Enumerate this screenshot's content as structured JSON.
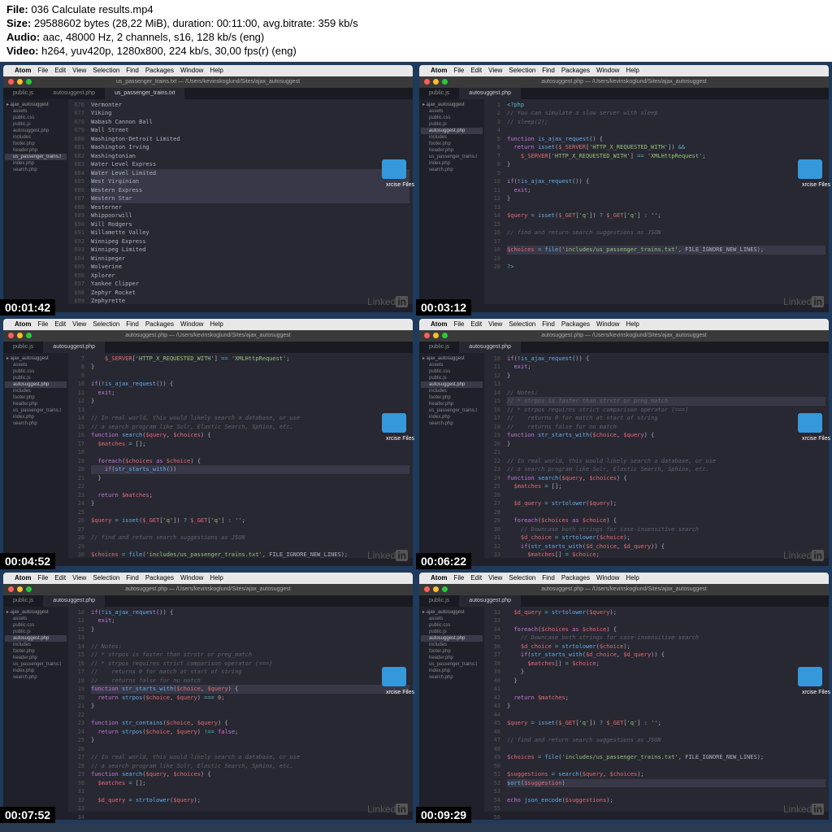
{
  "metadata": {
    "file_label": "File:",
    "file_name": "036 Calculate results.mp4",
    "size_label": "Size:",
    "size_value": "29588602 bytes (28,22 MiB), duration: 00:11:00, avg.bitrate: 359 kb/s",
    "audio_label": "Audio:",
    "audio_value": "aac, 48000 Hz, 2 channels, s16, 128 kb/s (eng)",
    "video_label": "Video:",
    "video_value": "h264, yuv420p, 1280x800, 224 kb/s, 30,00 fps(r) (eng)"
  },
  "menubar": {
    "apple": "",
    "items": [
      "Atom",
      "File",
      "Edit",
      "View",
      "Selection",
      "Find",
      "Packages",
      "Window",
      "Help"
    ]
  },
  "sidebar": {
    "folders": [
      {
        "name": "ajax_autosuggest",
        "files": [
          {
            "name": "assets"
          },
          {
            "name": "public.css"
          },
          {
            "name": "public.js"
          },
          {
            "name": "autosuggest.php"
          },
          {
            "name": "includes"
          },
          {
            "name": "footer.php"
          },
          {
            "name": "header.php"
          },
          {
            "name": "us_passenger_trains.t"
          },
          {
            "name": "index.php"
          },
          {
            "name": "search.php"
          }
        ]
      }
    ]
  },
  "tabs_both": [
    "public.js",
    "autosuggest.php"
  ],
  "window_title_trains": "us_passenger_trains.txt — /Users/kevinskoglund/Sites/ajax_autosuggest",
  "window_title_php": "autosuggest.php — /Users/kevinskoglund/Sites/ajax_autosuggest",
  "desktop_folder": "xrcise Files",
  "linkedin": "Linked",
  "linkedin_in": "in",
  "frames": [
    {
      "time": "00:01:42",
      "title": "us_passenger_trains.txt — /Users/kevinskoglund/Sites/ajax_autosuggest",
      "tabs": [
        "public.js",
        "autosuggest.php",
        "us_passenger_trains.txt"
      ],
      "active_tab": 2,
      "gutter_start": 676,
      "highlight": [
        684,
        685,
        686,
        687
      ],
      "lines": [
        "Vermonter",
        "Viking",
        "Wabash Cannon Ball",
        "Wall Street",
        "Washington-Detroit Limited",
        "Washington Irving",
        "Washingtonian",
        "Water Level Express",
        "Water Level Limited",
        "West Virginian",
        "Western Express",
        "Western Star",
        "Westerner",
        "Whippoorwill",
        "Will Rodgers",
        "Willamette Valley",
        "Winnipeg Express",
        "Winnipeg Limited",
        "Winnipeger",
        "Wolverine",
        "Xplorer",
        "Yankee Clipper",
        "Zephyr Rocket",
        "Zephyrette"
      ]
    },
    {
      "time": "00:03:12",
      "title": "autosuggest.php — /Users/kevinskoglund/Sites/ajax_autosuggest",
      "tabs": [
        "public.js",
        "autosuggest.php"
      ],
      "active_tab": 1,
      "gutter_start": 1,
      "highlight": [
        18
      ],
      "code": "<span class='c-op'>&lt;?php</span>\n<span class='c-com'>// You can simulate a slow server with sleep</span>\n<span class='c-com'>// sleep(2);</span>\n\n<span class='c-kw'>function</span> <span class='c-fn'>is_ajax_request</span>() {\n  <span class='c-kw'>return</span> <span class='c-fn'>isset</span>(<span class='c-var'>$_SERVER</span>[<span class='c-str'>'HTTP_X_REQUESTED_WITH'</span>]) <span class='c-op'>&&</span>\n    <span class='c-var'>$_SERVER</span>[<span class='c-str'>'HTTP_X_REQUESTED_WITH'</span>] <span class='c-op'>==</span> <span class='c-str'>'XMLHttpRequest'</span>;\n}\n\n<span class='c-kw'>if</span>(!<span class='c-fn'>is_ajax_request</span>()) {\n  <span class='c-kw'>exit</span>;\n}\n\n<span class='c-var'>$query</span> <span class='c-op'>=</span> <span class='c-fn'>isset</span>(<span class='c-var'>$_GET</span>[<span class='c-str'>'q'</span>]) <span class='c-op'>?</span> <span class='c-var'>$_GET</span>[<span class='c-str'>'q'</span>] <span class='c-op'>:</span> <span class='c-str'>''</span>;\n\n<span class='c-com'>// find and return search suggestions as JSON</span>\n\n<span class='hl-line'><span class='c-var'>$choices</span> <span class='c-op'>=</span> <span class='c-fn'>file</span>(<span class='c-str'>'includes/us_passenger_trains.txt'</span>, FILE_IGNORE_NEW_LINES);</span>\n\n<span class='c-op'>?&gt;</span>"
    },
    {
      "time": "00:04:52",
      "title": "autosuggest.php — /Users/kevinskoglund/Sites/ajax_autosuggest",
      "tabs": [
        "public.js",
        "autosuggest.php"
      ],
      "active_tab": 1,
      "gutter_start": 7,
      "highlight": [
        20
      ],
      "code": "    <span class='c-var'>$_SERVER</span>[<span class='c-str'>'HTTP_X_REQUESTED_WITH'</span>] <span class='c-op'>==</span> <span class='c-str'>'XMLHttpRequest'</span>;\n}\n\n<span class='c-kw'>if</span>(!<span class='c-fn'>is_ajax_request</span>()) {\n  <span class='c-kw'>exit</span>;\n}\n\n<span class='c-com'>// In real world, this would likely search a database, or use</span>\n<span class='c-com'>// a search program like Solr, Elastic Search, Sphinx, etc.</span>\n<span class='c-kw'>function</span> <span class='c-fn'>search</span>(<span class='c-var'>$query</span>, <span class='c-var'>$choices</span>) {\n  <span class='c-var'>$matches</span> <span class='c-op'>=</span> [];\n\n  <span class='c-kw'>foreach</span>(<span class='c-var'>$choices</span> <span class='c-kw'>as</span> <span class='c-var'>$choice</span>) {\n<span class='hl-line'>    <span class='c-kw'>if</span>(<span class='c-fn'>str_starts_with</span>())</span>\n  }\n\n  <span class='c-kw'>return</span> <span class='c-var'>$matches</span>;\n}\n\n<span class='c-var'>$query</span> <span class='c-op'>=</span> <span class='c-fn'>isset</span>(<span class='c-var'>$_GET</span>[<span class='c-str'>'q'</span>]) <span class='c-op'>?</span> <span class='c-var'>$_GET</span>[<span class='c-str'>'q'</span>] <span class='c-op'>:</span> <span class='c-str'>''</span>;\n\n<span class='c-com'>// find and return search suggestions as JSON</span>\n\n<span class='c-var'>$choices</span> <span class='c-op'>=</span> <span class='c-fn'>file</span>(<span class='c-str'>'includes/us_passenger_trains.txt'</span>, FILE_IGNORE_NEW_LINES);"
    },
    {
      "time": "00:06:22",
      "title": "autosuggest.php — /Users/kevinskoglund/Sites/ajax_autosuggest",
      "tabs": [
        "public.js",
        "autosuggest.php"
      ],
      "active_tab": 1,
      "gutter_start": 10,
      "highlight": [
        15
      ],
      "code": "<span class='c-kw'>if</span>(!<span class='c-fn'>is_ajax_request</span>()) {\n  <span class='c-kw'>exit</span>;\n}\n\n<span class='c-com'>// Notes:</span>\n<span class='hl-line'><span class='c-com'>// * strpos is faster than strstr or preg_match</span></span>\n<span class='c-com'>// * strpos requires strict comparison operator (===)</span>\n<span class='c-com'>//    returns 0 for match at start of string</span>\n<span class='c-com'>//    returns false for no match</span>\n<span class='c-kw'>function</span> <span class='c-fn'>str_starts_with</span>(<span class='c-var'>$choice</span>, <span class='c-var'>$query</span>) {\n}\n\n<span class='c-com'>// In real world, this would likely search a database, or use</span>\n<span class='c-com'>// a search program like Solr, Elastic Search, Sphinx, etc.</span>\n<span class='c-kw'>function</span> <span class='c-fn'>search</span>(<span class='c-var'>$query</span>, <span class='c-var'>$choices</span>) {\n  <span class='c-var'>$matches</span> <span class='c-op'>=</span> [];\n\n  <span class='c-var'>$d_query</span> <span class='c-op'>=</span> <span class='c-fn'>strtolower</span>(<span class='c-var'>$query</span>);\n\n  <span class='c-kw'>foreach</span>(<span class='c-var'>$choices</span> <span class='c-kw'>as</span> <span class='c-var'>$choice</span>) {\n    <span class='c-com'>// Downcase both strings for case-insensitive search</span>\n    <span class='c-var'>$d_choice</span> <span class='c-op'>=</span> <span class='c-fn'>strtolower</span>(<span class='c-var'>$choice</span>);\n    <span class='c-kw'>if</span>(<span class='c-fn'>str_starts_with</span>(<span class='c-var'>$d_choice</span>, <span class='c-var'>$d_query</span>)) {\n      <span class='c-var'>$matches</span>[] <span class='c-op'>=</span> <span class='c-var'>$choice</span>;"
    },
    {
      "time": "00:07:52",
      "title": "autosuggest.php — /Users/kevinskoglund/Sites/ajax_autosuggest",
      "tabs": [
        "public.js",
        "autosuggest.php"
      ],
      "active_tab": 1,
      "gutter_start": 10,
      "highlight": [
        19
      ],
      "code": "<span class='c-kw'>if</span>(!<span class='c-fn'>is_ajax_request</span>()) {\n  <span class='c-kw'>exit</span>;\n}\n\n<span class='c-com'>// Notes:</span>\n<span class='c-com'>// * strpos is faster than strstr or preg_match</span>\n<span class='c-com'>// * strpos requires strict comparison operator (===)</span>\n<span class='c-com'>//    returns 0 for match at start of string</span>\n<span class='c-com'>//    returns false for no match</span>\n<span class='hl-line'><span class='c-kw'>function</span> <span class='c-fn'>str_starts_with</span>(<span class='c-var'>$choice</span>, <span class='c-var'>$query</span>) {</span>\n  <span class='c-kw'>return</span> <span class='c-fn'>strpos</span>(<span class='c-var'>$choice</span>, <span class='c-var'>$query</span>) <span class='c-op'>===</span> <span class='c-num'>0</span>;\n}\n\n<span class='c-kw'>function</span> <span class='c-fn'>str_contains</span>(<span class='c-var'>$choice</span>, <span class='c-var'>$query</span>) {\n  <span class='c-kw'>return</span> <span class='c-fn'>strpos</span>(<span class='c-var'>$choice</span>, <span class='c-var'>$query</span>) <span class='c-op'>!==</span> <span class='c-kw'>false</span>;\n}\n\n<span class='c-com'>// In real world, this would likely search a database, or use</span>\n<span class='c-com'>// a search program like Solr, Elastic Search, Sphinx, etc.</span>\n<span class='c-kw'>function</span> <span class='c-fn'>search</span>(<span class='c-var'>$query</span>, <span class='c-var'>$choices</span>) {\n  <span class='c-var'>$matches</span> <span class='c-op'>=</span> [];\n\n  <span class='c-var'>$d_query</span> <span class='c-op'>=</span> <span class='c-fn'>strtolower</span>(<span class='c-var'>$query</span>);\n\n  <span class='c-kw'>foreach</span>(<span class='c-var'>$choices</span> <span class='c-kw'>as</span> <span class='c-var'>$choice</span>) {"
    },
    {
      "time": "00:09:29",
      "title": "autosuggest.php — /Users/kevinskoglund/Sites/ajax_autosuggest",
      "tabs": [
        "public.js",
        "autosuggest.php"
      ],
      "active_tab": 1,
      "gutter_start": 32,
      "highlight": [
        52
      ],
      "code": "  <span class='c-var'>$d_query</span> <span class='c-op'>=</span> <span class='c-fn'>strtolower</span>(<span class='c-var'>$query</span>);\n\n  <span class='c-kw'>foreach</span>(<span class='c-var'>$choices</span> <span class='c-kw'>as</span> <span class='c-var'>$choice</span>) {\n    <span class='c-com'>// Downcase both strings for case-insensitive search</span>\n    <span class='c-var'>$d_choice</span> <span class='c-op'>=</span> <span class='c-fn'>strtolower</span>(<span class='c-var'>$choice</span>);\n    <span class='c-kw'>if</span>(<span class='c-fn'>str_starts_with</span>(<span class='c-var'>$d_choice</span>, <span class='c-var'>$d_query</span>)) {\n      <span class='c-var'>$matches</span>[] <span class='c-op'>=</span> <span class='c-var'>$choice</span>;\n    }\n  }\n\n  <span class='c-kw'>return</span> <span class='c-var'>$matches</span>;\n}\n\n<span class='c-var'>$query</span> <span class='c-op'>=</span> <span class='c-fn'>isset</span>(<span class='c-var'>$_GET</span>[<span class='c-str'>'q'</span>]) <span class='c-op'>?</span> <span class='c-var'>$_GET</span>[<span class='c-str'>'q'</span>] <span class='c-op'>:</span> <span class='c-str'>''</span>;\n\n<span class='c-com'>// find and return search suggestions as JSON</span>\n\n<span class='c-var'>$choices</span> <span class='c-op'>=</span> <span class='c-fn'>file</span>(<span class='c-str'>'includes/us_passenger_trains.txt'</span>, FILE_IGNORE_NEW_LINES);\n\n<span class='c-var'>$suggestions</span> <span class='c-op'>=</span> <span class='c-fn'>search</span>(<span class='c-var'>$query</span>, <span class='c-var'>$choices</span>);\n<span class='hl-line'><span class='c-fn'>sort</span>(<span class='c-var'>$suggestion</span>)</span>\n\n<span class='c-kw'>echo</span> <span class='c-fn'>json_encode</span>(<span class='c-var'>$suggestions</span>);\n\n<span class='c-op'>?&gt;</span>"
    }
  ]
}
